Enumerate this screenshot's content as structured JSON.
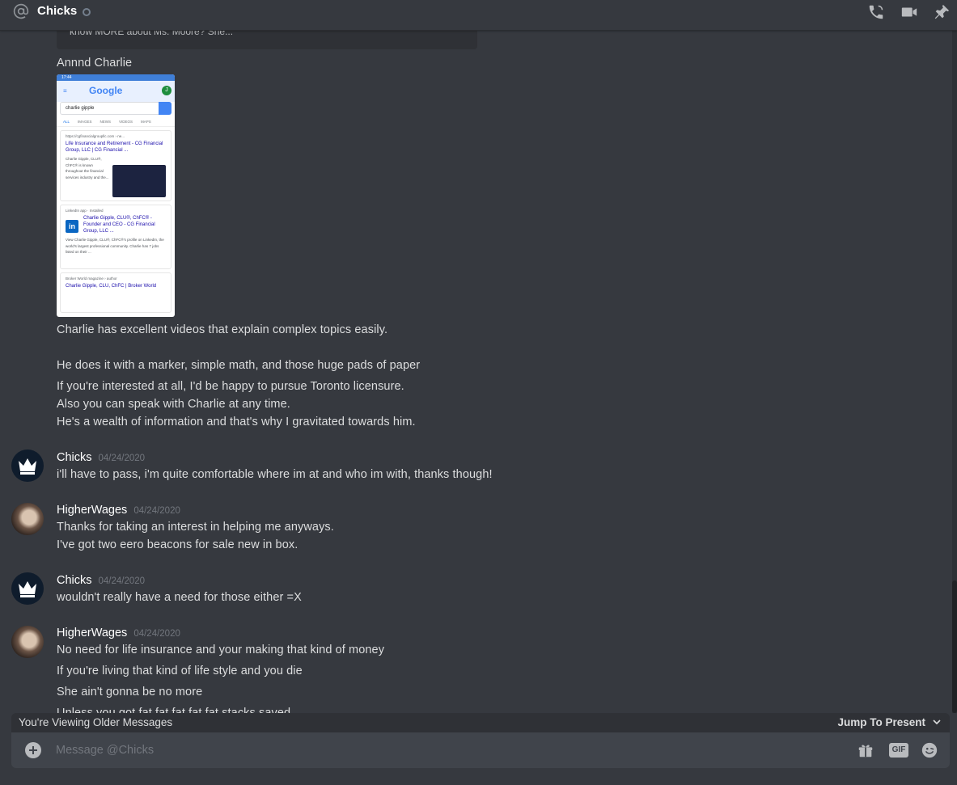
{
  "header": {
    "title": "Chicks",
    "at_icon": "at-icon",
    "icons": [
      "call-icon",
      "video-icon",
      "pin-icon"
    ]
  },
  "embed_tail": {
    "text": "know MORE about Ms. Moore? She..."
  },
  "messages": [
    {
      "type": "continuation",
      "text": "Annnd Charlie"
    },
    {
      "type": "attachment",
      "phone": {
        "status": "17:44",
        "logo": "Google",
        "account": "J",
        "query": "charlie gipple",
        "tabs": [
          "ALL",
          "IMAGES",
          "NEWS",
          "VIDEOS",
          "MAPS"
        ],
        "results": [
          {
            "url": "https://cgfinancialgroupllc.com › ne...",
            "title": "Life Insurance and Retirement - CG Financial Group, LLC | CG Financial ...",
            "snippet": "Charlie Gipple, CLU®, ChFC® is known throughout the financial services industry and the..."
          },
          {
            "url": "LinkedIn app · Installed",
            "title": "Charlie Gipple, CLU®, ChFC® - Founder and CEO - CG Financial Group, LLC ...",
            "snippet": "View Charlie Gipple, CLU®, ChFC®'s profile on LinkedIn, the world's largest professional community. Charlie has 7 jobs listed on their ..."
          },
          {
            "url": "Broker World magazine › author",
            "title": "Charlie Gipple, CLU, ChFC | Broker World",
            "snippet": ""
          }
        ]
      }
    },
    {
      "type": "continuation",
      "text": "Charlie has excellent videos that explain complex topics easily."
    },
    {
      "type": "continuation",
      "text": "He does it with a marker, simple math, and those huge pads of paper"
    },
    {
      "type": "continuation",
      "text": "If you're interested at all, I'd be happy to pursue Toronto licensure."
    },
    {
      "type": "continuation",
      "text": "Also you can speak with Charlie at any time."
    },
    {
      "type": "continuation",
      "text": " He's a wealth of information and that's why I gravitated towards him."
    }
  ],
  "groups": [
    {
      "author": "Chicks",
      "timestamp": "04/24/2020",
      "lines": [
        "i'll have to pass, i'm quite comfortable where im at and who im with, thanks though!"
      ]
    },
    {
      "author": "HigherWages",
      "timestamp": "04/24/2020",
      "lines": [
        "Thanks for taking an interest in helping me anyways.",
        "I've got two eero beacons for sale new in box."
      ]
    },
    {
      "author": "Chicks",
      "timestamp": "04/24/2020",
      "lines": [
        "wouldn't really have a need for those either =X"
      ]
    },
    {
      "author": "HigherWages",
      "timestamp": "04/24/2020",
      "lines": [
        "No need for life insurance and your making that kind of money",
        "If you're living that kind of life style and you die",
        "She ain't gonna be no more",
        "Unless you got fat fat fat fat fat stacks saved"
      ]
    }
  ],
  "composer": {
    "older_notice": "You're Viewing Older Messages",
    "jump_label": "Jump To Present",
    "placeholder": "Message @Chicks",
    "gif_label": "GIF"
  }
}
